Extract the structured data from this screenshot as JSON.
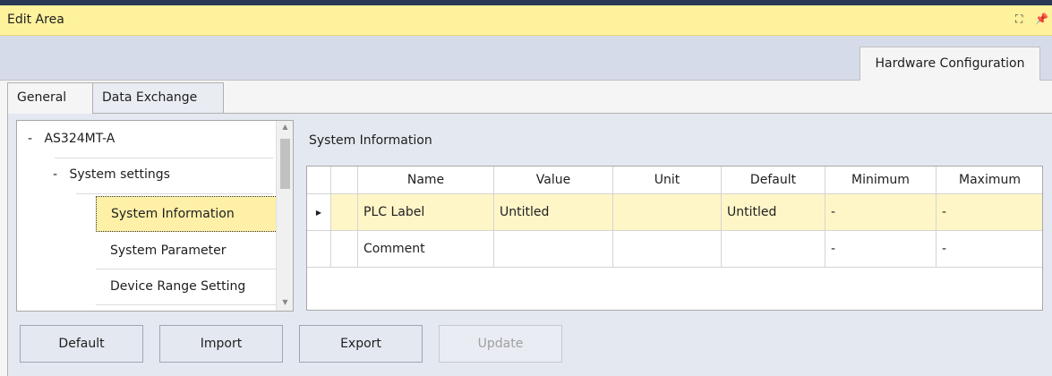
{
  "window": {
    "title": "Edit Area",
    "icons": [
      "float-icon",
      "pin-icon"
    ]
  },
  "top_tab": {
    "label": "Hardware Configuration"
  },
  "tabs": [
    {
      "label": "General",
      "active": true
    },
    {
      "label": "Data Exchange",
      "active": false
    }
  ],
  "tree": {
    "root": {
      "prefix": "-",
      "label": "AS324MT-A"
    },
    "group": {
      "prefix": "-",
      "label": "System settings"
    },
    "items": [
      {
        "label": "System Information",
        "selected": true
      },
      {
        "label": "System Parameter",
        "selected": false
      },
      {
        "label": "Device Range Setting",
        "selected": false
      }
    ]
  },
  "section": {
    "title": "System Information"
  },
  "grid": {
    "columns": [
      "Name",
      "Value",
      "Unit",
      "Default",
      "Minimum",
      "Maximum"
    ],
    "rows": [
      {
        "indicator": "▶",
        "name": "PLC Label",
        "value": "Untitled",
        "unit": "",
        "default": "Untitled",
        "minimum": "-",
        "maximum": "-",
        "selected": true
      },
      {
        "indicator": "",
        "name": "Comment",
        "value": "",
        "unit": "",
        "default": "",
        "minimum": "-",
        "maximum": "-",
        "selected": false
      }
    ]
  },
  "buttons": {
    "default": "Default",
    "import": "Import",
    "export": "Export",
    "update": "Update"
  },
  "colors": {
    "title_bar": "#fff29d",
    "selection": "#fff0a8",
    "background": "#d6dbe9"
  }
}
